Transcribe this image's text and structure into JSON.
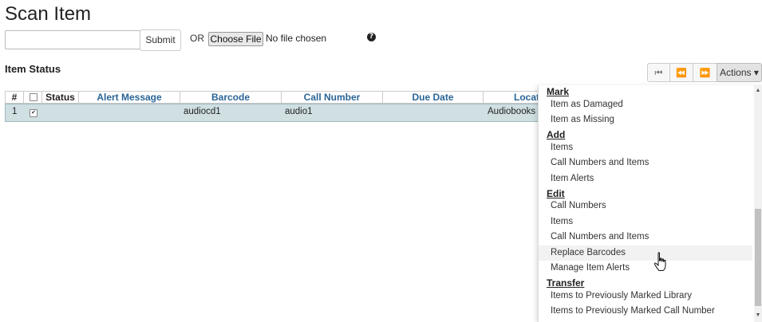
{
  "page": {
    "title": "Scan Item"
  },
  "scan": {
    "input_value": "",
    "submit_label": "Submit",
    "or_label": "OR",
    "choose_file_label": "Choose File",
    "file_status": "No file chosen",
    "help_icon": "question-circle-icon"
  },
  "item_status": {
    "title": "Item Status",
    "nav": {
      "first_icon": "⏮",
      "prev_icon": "⏪",
      "next_icon": "⏩",
      "actions_label": "Actions ▾"
    },
    "columns": [
      "#",
      "",
      "Status",
      "Alert Message",
      "Barcode",
      "Call Number",
      "Due Date",
      "Locat"
    ],
    "rows": [
      {
        "index": "1",
        "checked": true,
        "status": "",
        "alert_message": "",
        "barcode": "audiocd1",
        "call_number": "audio1",
        "due_date": "",
        "location": "Audiobooks"
      }
    ]
  },
  "actions_menu": {
    "sections": [
      {
        "heading": "Mark",
        "items": [
          "Item as Damaged",
          "Item as Missing"
        ]
      },
      {
        "heading": "Add",
        "items": [
          "Items",
          "Call Numbers and Items",
          "Item Alerts"
        ]
      },
      {
        "heading": "Edit",
        "items": [
          "Call Numbers",
          "Items",
          "Call Numbers and Items",
          "Replace Barcodes",
          "Manage Item Alerts"
        ]
      },
      {
        "heading": "Transfer",
        "items": [
          "Items to Previously Marked Library",
          "Items to Previously Marked Call Number"
        ]
      }
    ],
    "hovered_item": "Replace Barcodes"
  },
  "colors": {
    "row_selected": "#cfdfe2",
    "header_link": "#2a6496",
    "menu_hover": "#f2f2f2"
  }
}
